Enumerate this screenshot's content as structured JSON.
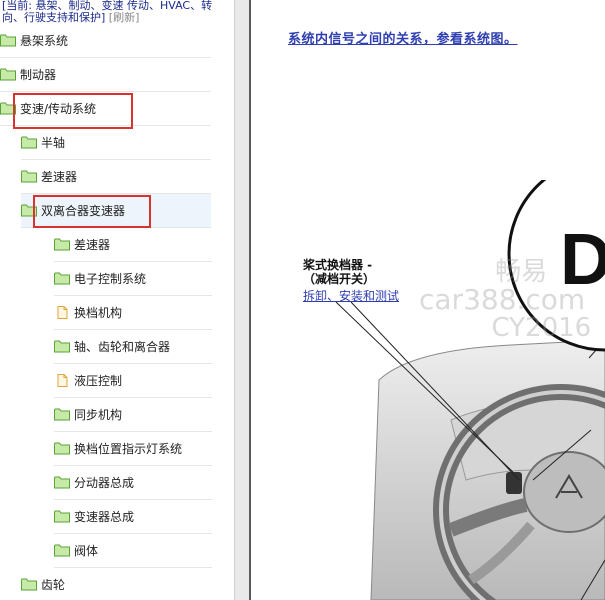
{
  "breadcrumb": {
    "text": "[当前: 悬架、制动、变速 传动、HVAC、转向、行驶支持和保护]",
    "refresh": "[刷新]"
  },
  "tree": {
    "items": [
      {
        "label": "悬架系统",
        "level": 0,
        "icon": "folder-icon"
      },
      {
        "label": "制动器",
        "level": 0,
        "icon": "folder-icon"
      },
      {
        "label": "变速/传动系统",
        "level": 0,
        "icon": "folder-icon",
        "highlighted": true
      },
      {
        "label": "半轴",
        "level": 1,
        "icon": "folder-icon"
      },
      {
        "label": "差速器",
        "level": 1,
        "icon": "folder-icon"
      },
      {
        "label": "双离合器变速器",
        "level": 1,
        "icon": "folder-icon",
        "highlighted": true,
        "selected": true
      },
      {
        "label": "差速器",
        "level": 2,
        "icon": "folder-icon"
      },
      {
        "label": "电子控制系统",
        "level": 2,
        "icon": "folder-icon"
      },
      {
        "label": "换档机构",
        "level": 2,
        "icon": "document-icon"
      },
      {
        "label": "轴、齿轮和离合器",
        "level": 2,
        "icon": "folder-icon"
      },
      {
        "label": "液压控制",
        "level": 2,
        "icon": "document-icon"
      },
      {
        "label": "同步机构",
        "level": 2,
        "icon": "folder-icon"
      },
      {
        "label": "换档位置指示灯系统",
        "level": 2,
        "icon": "folder-icon"
      },
      {
        "label": "分动器总成",
        "level": 2,
        "icon": "folder-icon"
      },
      {
        "label": "变速器总成",
        "level": 2,
        "icon": "folder-icon"
      },
      {
        "label": "阀体",
        "level": 2,
        "icon": "folder-icon"
      },
      {
        "label": "齿轮",
        "level": 1,
        "icon": "folder-icon"
      }
    ]
  },
  "document": {
    "system_link": "系统内信号之间的关系，参看系统图。",
    "callout_title_line1": "桨式换档器 -",
    "callout_title_line2": "（减档开关）",
    "callout_link": "拆卸、安装和测试",
    "diagram_letter": "D"
  },
  "watermark": {
    "line1": "畅易",
    "line2": "car388.com",
    "line3": "CY2016"
  },
  "colors": {
    "highlight_box": "#d8342f",
    "link": "#2f3fb0",
    "folder": "#9bd47a",
    "selected_row": "#eef4fb"
  }
}
